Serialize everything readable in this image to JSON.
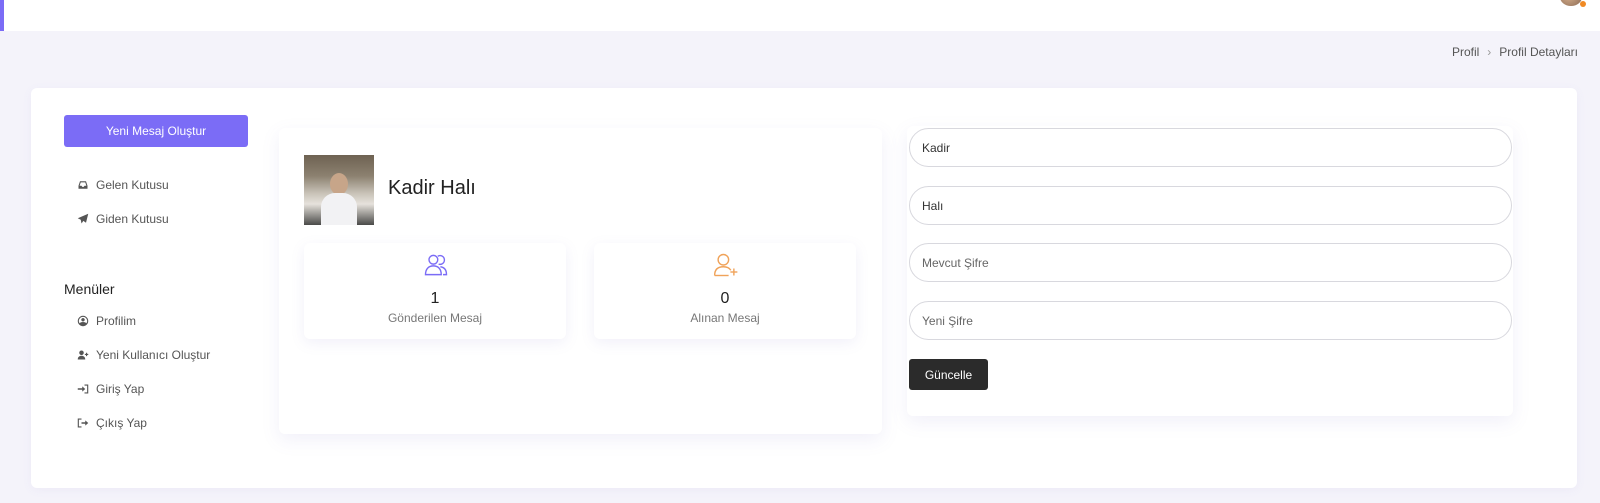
{
  "breadcrumb": {
    "items": [
      "Profil",
      "Profil Detayları"
    ]
  },
  "sidebar": {
    "new_message_label": "Yeni Mesaj Oluştur",
    "mail_items": [
      {
        "label": "Gelen Kutusu",
        "icon": "inbox-icon"
      },
      {
        "label": "Giden Kutusu",
        "icon": "paper-plane-icon"
      }
    ],
    "menu_title": "Menüler",
    "menu_items": [
      {
        "label": "Profilim",
        "icon": "user-circle-icon"
      },
      {
        "label": "Yeni Kullanıcı Oluştur",
        "icon": "user-plus-icon"
      },
      {
        "label": "Giriş Yap",
        "icon": "sign-in-icon"
      },
      {
        "label": "Çıkış Yap",
        "icon": "sign-out-icon"
      }
    ]
  },
  "profile": {
    "name": "Kadir Halı",
    "stats": [
      {
        "value": "1",
        "label": "Gönderilen Mesaj",
        "icon": "users-icon",
        "color": "#7b6cf6"
      },
      {
        "value": "0",
        "label": "Alınan Mesaj",
        "icon": "user-plus-outline-icon",
        "color": "#f0a35a"
      }
    ]
  },
  "form": {
    "first_name_value": "Kadir",
    "last_name_value": "Halı",
    "current_password_placeholder": "Mevcut Şifre",
    "new_password_placeholder": "Yeni Şifre",
    "update_label": "Güncelle"
  },
  "colors": {
    "accent": "#7b6cf6",
    "dark_button": "#2b2b2b",
    "background": "#f4f3fa"
  }
}
